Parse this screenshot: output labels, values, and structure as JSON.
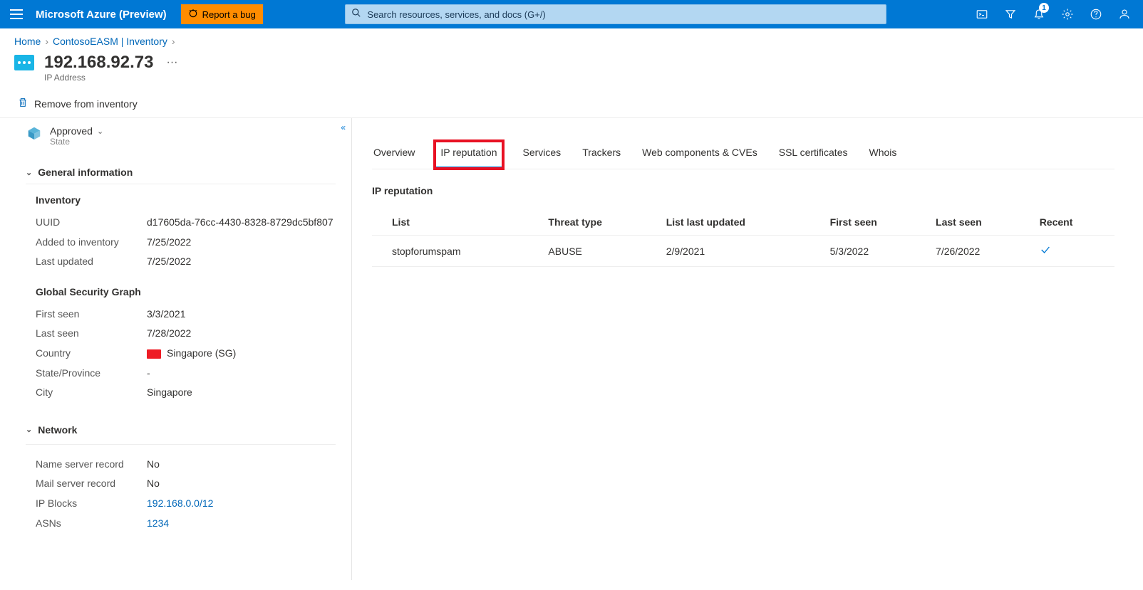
{
  "header": {
    "brand": "Microsoft Azure (Preview)",
    "report_bug": "Report a bug",
    "search_placeholder": "Search resources, services, and docs (G+/)",
    "notification_count": "1"
  },
  "breadcrumb": {
    "items": [
      "Home",
      "ContosoEASM | Inventory"
    ]
  },
  "page": {
    "title": "192.168.92.73",
    "subtitle": "IP Address",
    "remove_label": "Remove from inventory"
  },
  "state": {
    "value": "Approved",
    "label": "State"
  },
  "sections": {
    "general_header": "General information",
    "inventory_header": "Inventory",
    "gsg_header": "Global Security Graph",
    "network_header": "Network"
  },
  "inventory": {
    "uuid_label": "UUID",
    "uuid": "d17605da-76cc-4430-8328-8729dc5bf807",
    "added_label": "Added to inventory",
    "added": "7/25/2022",
    "updated_label": "Last updated",
    "updated": "7/25/2022"
  },
  "gsg": {
    "first_seen_label": "First seen",
    "first_seen": "3/3/2021",
    "last_seen_label": "Last seen",
    "last_seen": "7/28/2022",
    "country_label": "Country",
    "country": "Singapore (SG)",
    "state_label": "State/Province",
    "state": "-",
    "city_label": "City",
    "city": "Singapore"
  },
  "network": {
    "ns_label": "Name server record",
    "ns": "No",
    "mail_label": "Mail server record",
    "mail": "No",
    "ipblocks_label": "IP Blocks",
    "ipblocks": "192.168.0.0/12",
    "asns_label": "ASNs",
    "asns": "1234"
  },
  "tabs": {
    "overview": "Overview",
    "ip_reputation": "IP reputation",
    "services": "Services",
    "trackers": "Trackers",
    "web_components": "Web components & CVEs",
    "ssl": "SSL certificates",
    "whois": "Whois"
  },
  "panel": {
    "title": "IP reputation",
    "columns": {
      "list": "List",
      "threat": "Threat type",
      "list_updated": "List last updated",
      "first_seen": "First seen",
      "last_seen": "Last seen",
      "recent": "Recent"
    },
    "rows": [
      {
        "list": "stopforumspam",
        "threat": "ABUSE",
        "list_updated": "2/9/2021",
        "first_seen": "5/3/2022",
        "last_seen": "7/26/2022",
        "recent": "✓"
      }
    ]
  }
}
